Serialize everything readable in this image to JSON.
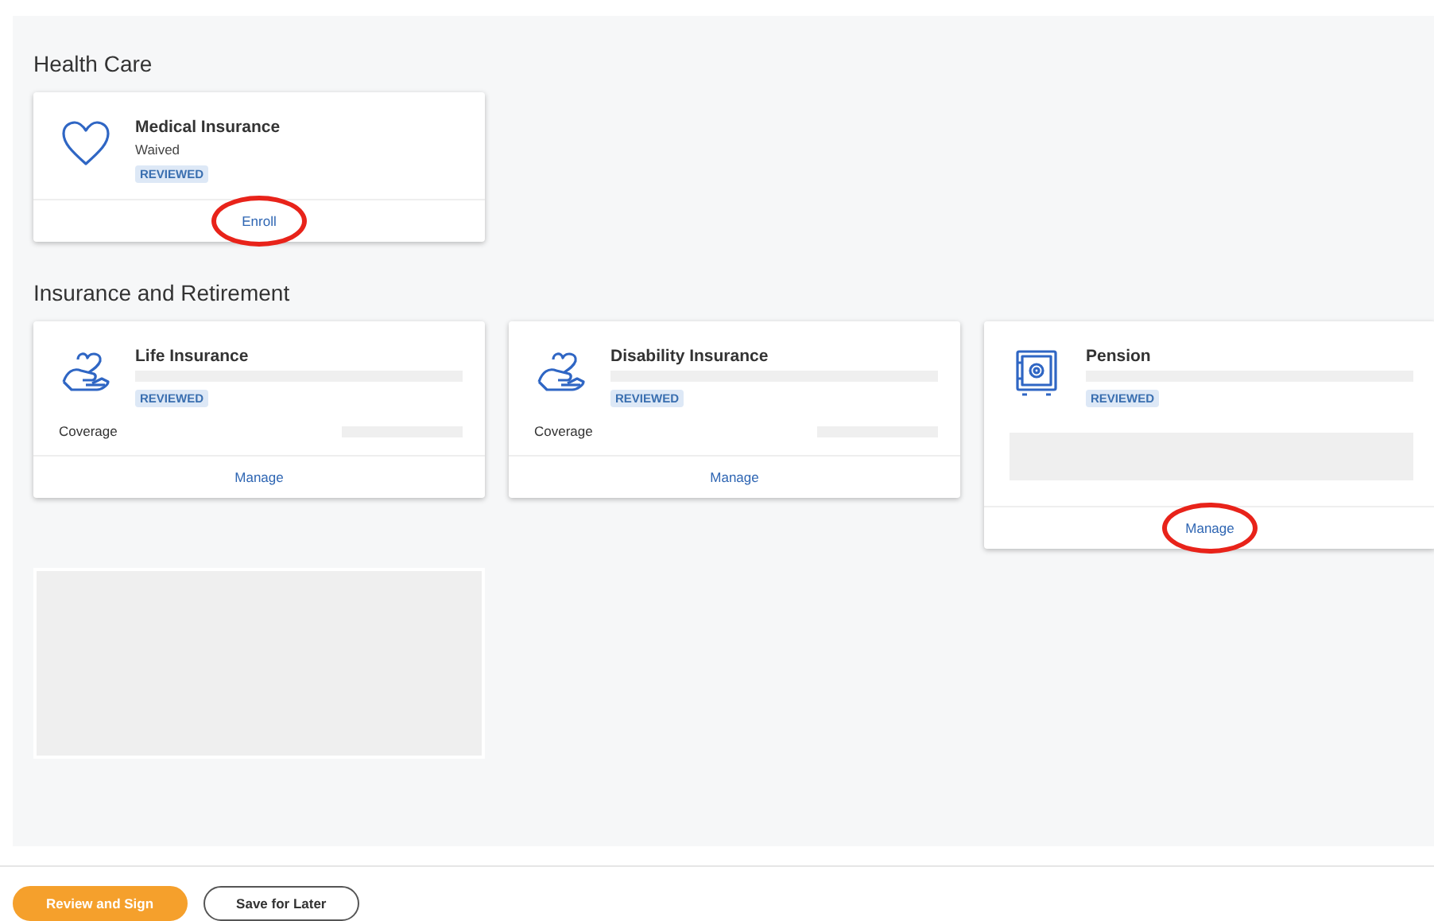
{
  "sections": [
    {
      "title": "Health Care",
      "cards": [
        {
          "kind": "status",
          "title": "Medical Insurance",
          "subtitle": "Waived",
          "badge": "REVIEWED",
          "action": {
            "label": "Enroll",
            "highlighted": true
          }
        }
      ]
    },
    {
      "title": "Insurance and Retirement",
      "cards": [
        {
          "kind": "coverage",
          "title": "Life Insurance",
          "badge": "REVIEWED",
          "row_label": "Coverage",
          "action": {
            "label": "Manage",
            "highlighted": false
          }
        },
        {
          "kind": "coverage",
          "title": "Disability Insurance",
          "badge": "REVIEWED",
          "row_label": "Coverage",
          "action": {
            "label": "Manage",
            "highlighted": false
          }
        },
        {
          "kind": "plan",
          "title": "Pension",
          "badge": "REVIEWED",
          "action": {
            "label": "Manage",
            "highlighted": true
          }
        },
        {
          "kind": "placeholder"
        }
      ]
    }
  ],
  "buttons": [
    {
      "label": "Review and Sign",
      "kind": "primary"
    },
    {
      "label": "Save for Later",
      "kind": "secondary"
    }
  ]
}
